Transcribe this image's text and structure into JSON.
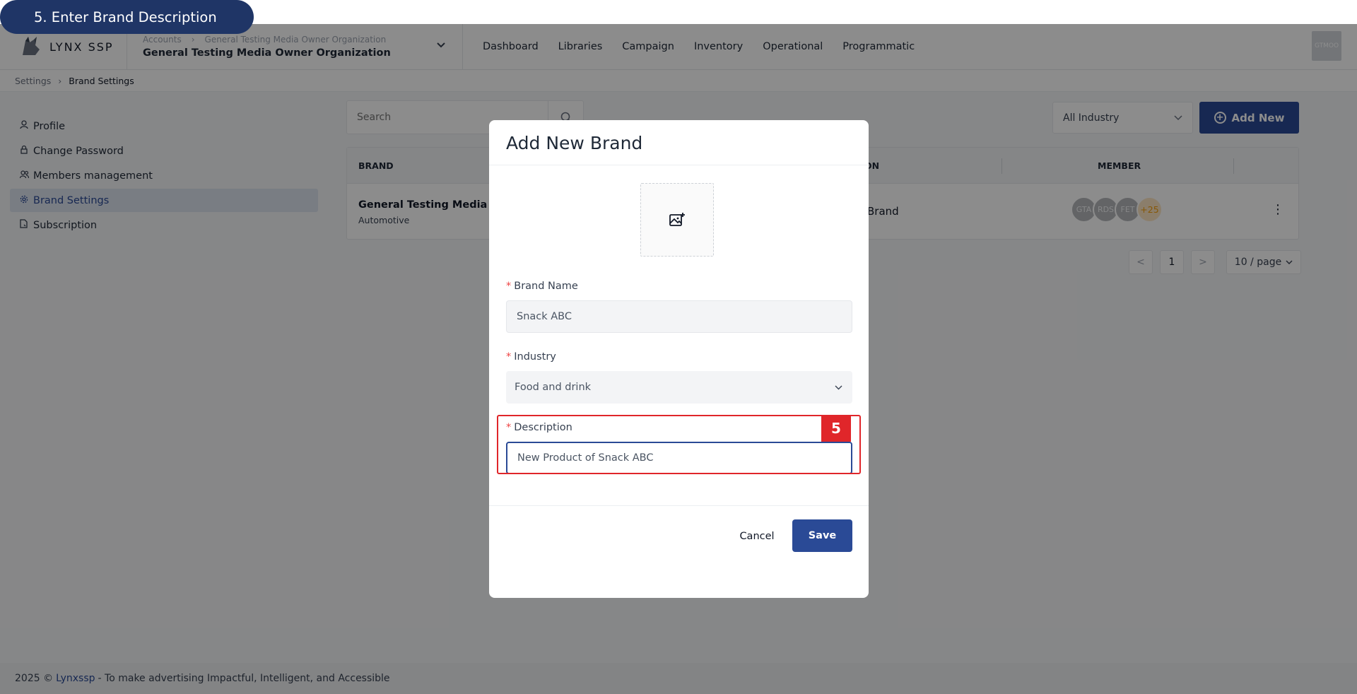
{
  "step": {
    "label": "5. Enter Brand Description",
    "badge": "5"
  },
  "header": {
    "logo_text": "LYNX SSP",
    "org_crumbs": [
      "Accounts",
      "General Testing Media Owner Organization"
    ],
    "org_name": "General Testing Media Owner Organization",
    "nav": [
      "Dashboard",
      "Libraries",
      "Campaign",
      "Inventory",
      "Operational",
      "Programmatic"
    ],
    "avatar_text": "GTMOO"
  },
  "breadcrumb": {
    "parent": "Settings",
    "current": "Brand Settings"
  },
  "sidebar": {
    "items": [
      {
        "label": "Profile",
        "icon": "user-icon"
      },
      {
        "label": "Change Password",
        "icon": "lock-icon"
      },
      {
        "label": "Members management",
        "icon": "users-icon"
      },
      {
        "label": "Brand Settings",
        "icon": "gear-icon",
        "active": true
      },
      {
        "label": "Subscription",
        "icon": "document-icon"
      }
    ]
  },
  "toolbar": {
    "search_placeholder": "Search",
    "industry_filter": "All Industry",
    "add_new_label": "Add New"
  },
  "table": {
    "headers": {
      "brand": "BRAND",
      "description_tail": "ON",
      "member": "MEMBER"
    },
    "rows": [
      {
        "brand": "General Testing Media Ow",
        "industry": "Automotive",
        "description_tail": "Brand",
        "members": [
          "GTA",
          "RDS",
          "FET"
        ],
        "more": "+25"
      }
    ]
  },
  "pagination": {
    "prev": "<",
    "current": "1",
    "next": ">",
    "page_size": "10 / page"
  },
  "footer": {
    "year": "2025 ©",
    "brand": "Lynxssp",
    "tagline": "- To make advertising Impactful, Intelligent, and Accessible"
  },
  "modal": {
    "title": "Add New Brand",
    "brand_name_label": "Brand Name",
    "brand_name_value": "Snack ABC",
    "industry_label": "Industry",
    "industry_value": "Food and drink",
    "description_label": "Description",
    "description_value": "New Product of Snack ABC",
    "required_mark": "*",
    "cancel_label": "Cancel",
    "save_label": "Save"
  },
  "colors": {
    "primary": "#2a4a96",
    "highlight": "#e0262a",
    "pill": "#1f3566"
  }
}
